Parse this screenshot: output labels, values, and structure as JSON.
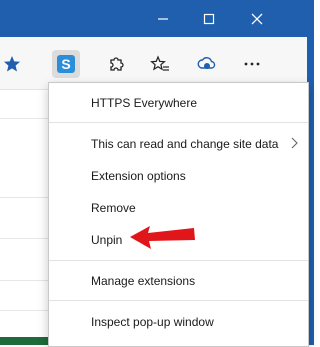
{
  "window_controls": {
    "minimize_icon": "minimize-icon",
    "maximize_icon": "maximize-icon",
    "close_icon": "close-icon"
  },
  "toolbar": {
    "icons": [
      "star-icon",
      "https-everywhere-extension-icon",
      "extensions-puzzle-icon",
      "favorites-icon",
      "cloud-icon",
      "more-icon"
    ],
    "extension_badge_letter": "S"
  },
  "context_menu": {
    "items": [
      {
        "label": "HTTPS Everywhere"
      },
      {
        "label": "This can read and change site data"
      },
      {
        "label": "Extension options"
      },
      {
        "label": "Remove"
      },
      {
        "label": "Unpin"
      },
      {
        "label": "Manage extensions"
      },
      {
        "label": "Inspect pop-up window"
      }
    ]
  },
  "colors": {
    "titlebar": "#1f5fae",
    "annotation_arrow": "#e0161b",
    "extension_badge": "#2a8fd8"
  }
}
